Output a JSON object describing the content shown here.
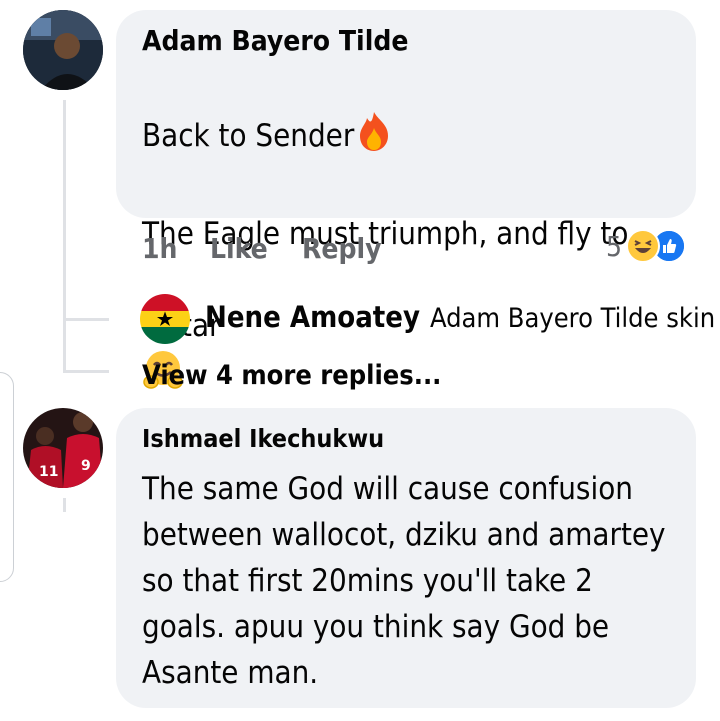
{
  "comments": [
    {
      "author": "Adam Bayero Tilde",
      "text_line1": "Back to Sender",
      "text_line2": "The Eagle must triumph, and fly to",
      "text_line3": "Qatar",
      "time": "1h",
      "like_label": "Like",
      "reply_label": "Reply",
      "reaction_count": "5",
      "reaction_icons": [
        "laughing-emoji",
        "like-thumb"
      ],
      "avatar_icon": "user-avatar-dark"
    },
    {
      "author": "Ishmael Ikechukwu",
      "text": "The same God will cause confusion\nbetween wallocot, dziku and amartey\nso that first 20mins you'll take 2\ngoals. apuu you think say God be\nAsante man.",
      "avatar_icon": "user-avatar-red-jersey"
    }
  ],
  "reply": {
    "author": "Nene Amoatey",
    "snippet": "Adam Bayero Tilde skin ...",
    "avatar_icon": "ghana-flag-avatar"
  },
  "view_more_label": "View 4 more replies...",
  "colors": {
    "bubble": "#f0f2f5",
    "meta": "#65676b",
    "like_blue": "#1877f2",
    "ghana_red": "#ce1126",
    "ghana_gold": "#fcd116",
    "ghana_green": "#006b3f"
  }
}
